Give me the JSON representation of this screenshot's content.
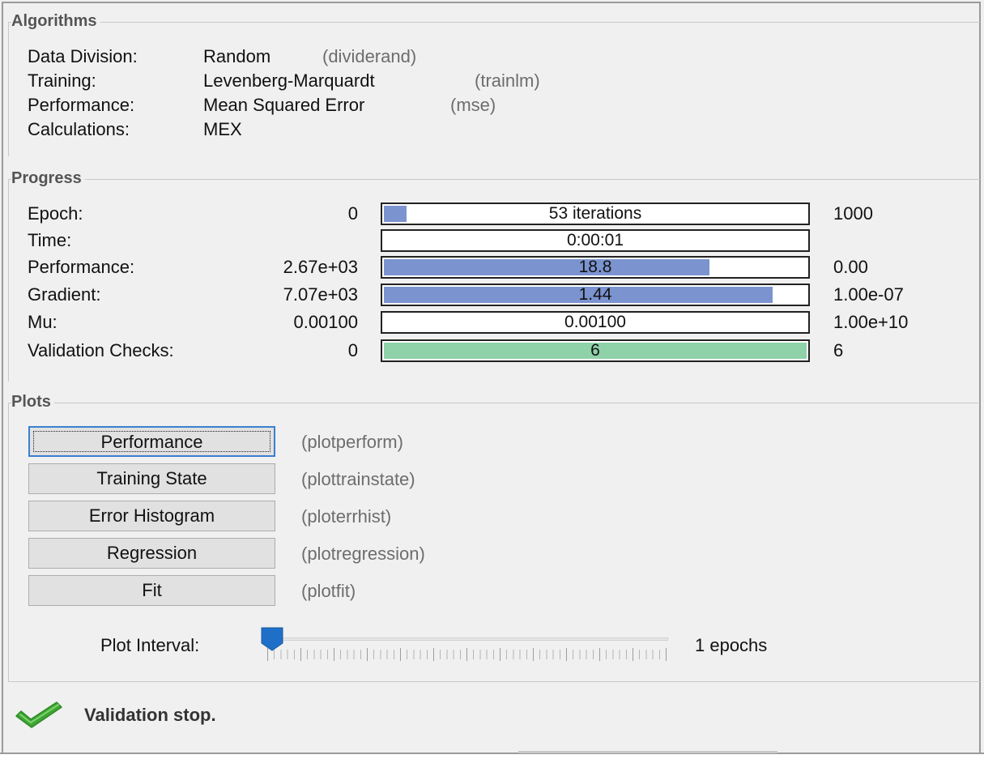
{
  "algorithms": {
    "title": "Algorithms",
    "rows": [
      {
        "label": "Data Division:",
        "value": "Random",
        "code": "(dividerand)"
      },
      {
        "label": "Training:",
        "value": "Levenberg-Marquardt",
        "code": "(trainlm)"
      },
      {
        "label": "Performance:",
        "value": "Mean Squared Error",
        "code": "(mse)"
      },
      {
        "label": "Calculations:",
        "value": "MEX",
        "code": ""
      }
    ]
  },
  "progress": {
    "title": "Progress",
    "rows": [
      {
        "label": "Epoch:",
        "start": "0",
        "current": "53 iterations",
        "end": "1000",
        "fill_fraction": 0.053,
        "color": "#7b93cf"
      },
      {
        "label": "Time:",
        "start": "",
        "current": "0:00:01",
        "end": "",
        "fill_fraction": 0.0,
        "color": "#7b93cf"
      },
      {
        "label": "Performance:",
        "start": "2.67e+03",
        "current": "18.8",
        "end": "0.00",
        "fill_fraction": 0.77,
        "color": "#7b93cf"
      },
      {
        "label": "Gradient:",
        "start": "7.07e+03",
        "current": "1.44",
        "end": "1.00e-07",
        "fill_fraction": 0.92,
        "color": "#7b93cf"
      },
      {
        "label": "Mu:",
        "start": "0.00100",
        "current": "0.00100",
        "end": "1.00e+10",
        "fill_fraction": 0.0,
        "color": "#7b93cf"
      },
      {
        "label": "Validation Checks:",
        "start": "0",
        "current": "6",
        "end": "6",
        "fill_fraction": 1.0,
        "color": "#8fd1a8"
      }
    ]
  },
  "plots": {
    "title": "Plots",
    "buttons": [
      {
        "label": "Performance",
        "code": "(plotperform)"
      },
      {
        "label": "Training State",
        "code": "(plottrainstate)"
      },
      {
        "label": "Error Histogram",
        "code": "(ploterrhist)"
      },
      {
        "label": "Regression",
        "code": "(plotregression)"
      },
      {
        "label": "Fit",
        "code": "(plotfit)"
      }
    ],
    "interval_label": "Plot Interval:",
    "interval_value": "1 epochs",
    "slider_fraction": 0.0
  },
  "status": {
    "icon": "check-icon",
    "icon_color": "#3fa635",
    "text": "Validation stop."
  }
}
